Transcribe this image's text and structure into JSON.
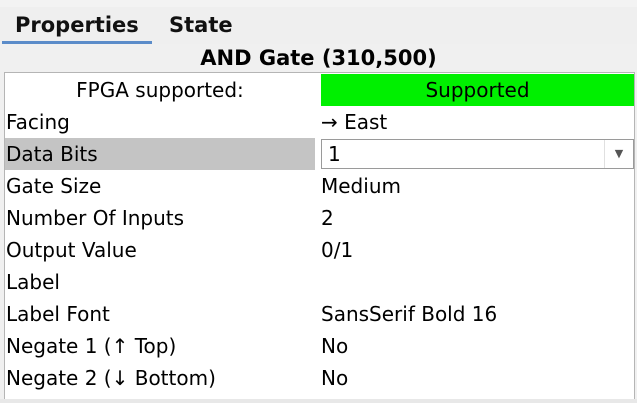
{
  "tabs": {
    "properties": "Properties",
    "state": "State"
  },
  "component_title": "AND Gate (310,500)",
  "properties": [
    {
      "key": "FPGA supported:",
      "value": "Supported"
    },
    {
      "key": "Facing",
      "value": "→ East"
    },
    {
      "key": "Data Bits",
      "value": "1"
    },
    {
      "key": "Gate Size",
      "value": "Medium"
    },
    {
      "key": "Number Of Inputs",
      "value": "2"
    },
    {
      "key": "Output Value",
      "value": "0/1"
    },
    {
      "key": "Label",
      "value": ""
    },
    {
      "key": "Label Font",
      "value": "SansSerif Bold 16"
    },
    {
      "key": "Negate 1 (↑ Top)",
      "value": "No"
    },
    {
      "key": "Negate 2 (↓ Bottom)",
      "value": "No"
    }
  ],
  "icons": {
    "dropdown": "chevron-down-icon"
  },
  "colors": {
    "supported_bg": "#00f000",
    "selected_row_bg": "#c4c4c4",
    "active_tab_underline": "#5b8cc9"
  }
}
